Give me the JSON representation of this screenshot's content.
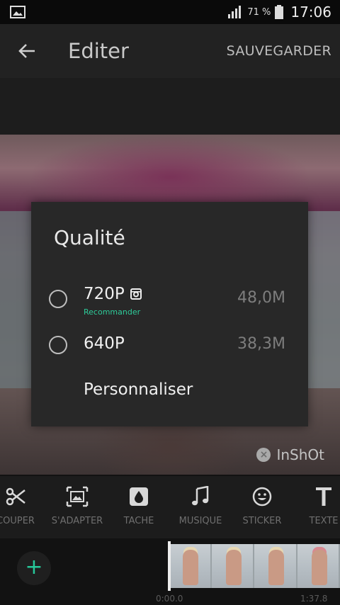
{
  "status": {
    "battery": "71 %",
    "time": "17:06"
  },
  "appbar": {
    "title": "Editer",
    "save": "SAUVEGARDER"
  },
  "dialog": {
    "title": "Qualité",
    "options": [
      {
        "label": "720P",
        "sub": "Recommander",
        "size": "48,0M"
      },
      {
        "label": "640P",
        "size": "38,3M"
      }
    ],
    "custom": "Personnaliser"
  },
  "watermark": {
    "text": "InShOt"
  },
  "tools": [
    {
      "label": "COUPER",
      "icon": "scissors-icon"
    },
    {
      "label": "S'ADAPTER",
      "icon": "fit-frame-icon"
    },
    {
      "label": "TACHE",
      "icon": "drop-icon"
    },
    {
      "label": "MUSIQUE",
      "icon": "music-note-icon"
    },
    {
      "label": "STICKER",
      "icon": "smiley-icon"
    },
    {
      "label": "TEXTE",
      "icon": "text-icon"
    }
  ],
  "timeline": {
    "start": "0:00.0",
    "end": "1:37.8"
  },
  "colors": {
    "accent": "#2ecc9a",
    "dialog": "#282828",
    "toolbar": "#1c1c1c"
  }
}
